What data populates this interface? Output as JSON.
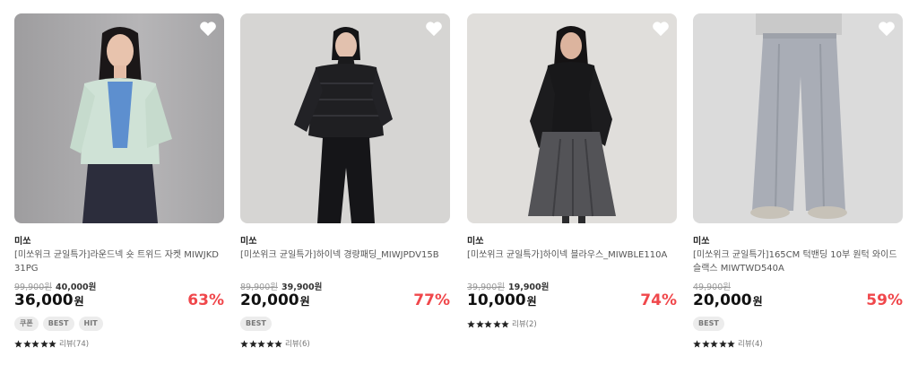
{
  "products": [
    {
      "brand": "미쏘",
      "name": "[미쏘위크 균일특가]라운드넥 숏 트위드 자켓 MIWJKD31PG",
      "original_price": "99,900원",
      "sale_price": "40,000원",
      "final_price": "36,000",
      "currency": "원",
      "discount": "63%",
      "badges": [
        "쿠폰",
        "BEST",
        "HIT"
      ],
      "stars": 5,
      "review_label": "리뷰(74)",
      "image_bg": "#a9a8aa",
      "image_icon": "model-tweed-jacket-image"
    },
    {
      "brand": "미쏘",
      "name": "[미쏘위크 균일특가]하이넥 경량패딩_MIWJPDV15B",
      "original_price": "89,900원",
      "sale_price": "39,900원",
      "final_price": "20,000",
      "currency": "원",
      "discount": "77%",
      "badges": [
        "BEST"
      ],
      "stars": 5,
      "review_label": "리뷰(6)",
      "image_bg": "#d7d6d4",
      "image_icon": "model-padding-image"
    },
    {
      "brand": "미쏘",
      "name": "[미쏘위크 균일특가]하이넥 블라우스_MIWBLE110A",
      "original_price": "39,900원",
      "sale_price": "19,900원",
      "final_price": "10,000",
      "currency": "원",
      "discount": "74%",
      "badges": [],
      "stars": 5,
      "review_label": "리뷰(2)",
      "image_bg": "#e1dfdc",
      "image_icon": "model-blouse-image"
    },
    {
      "brand": "미쏘",
      "name": "[미쏘위크 균일특가]165CM 턱밴딩 10부 원턱 와이드 슬랙스 MIWTWD540A",
      "original_price": "49,900원",
      "sale_price": "",
      "final_price": "20,000",
      "currency": "원",
      "discount": "59%",
      "badges": [
        "BEST"
      ],
      "stars": 5,
      "review_label": "리뷰(4)",
      "image_bg": "#dcdcdc",
      "image_icon": "model-slacks-image"
    }
  ],
  "colors": {
    "discount": "#f0474b",
    "star": "#222222",
    "badge_bg": "#ececec"
  }
}
